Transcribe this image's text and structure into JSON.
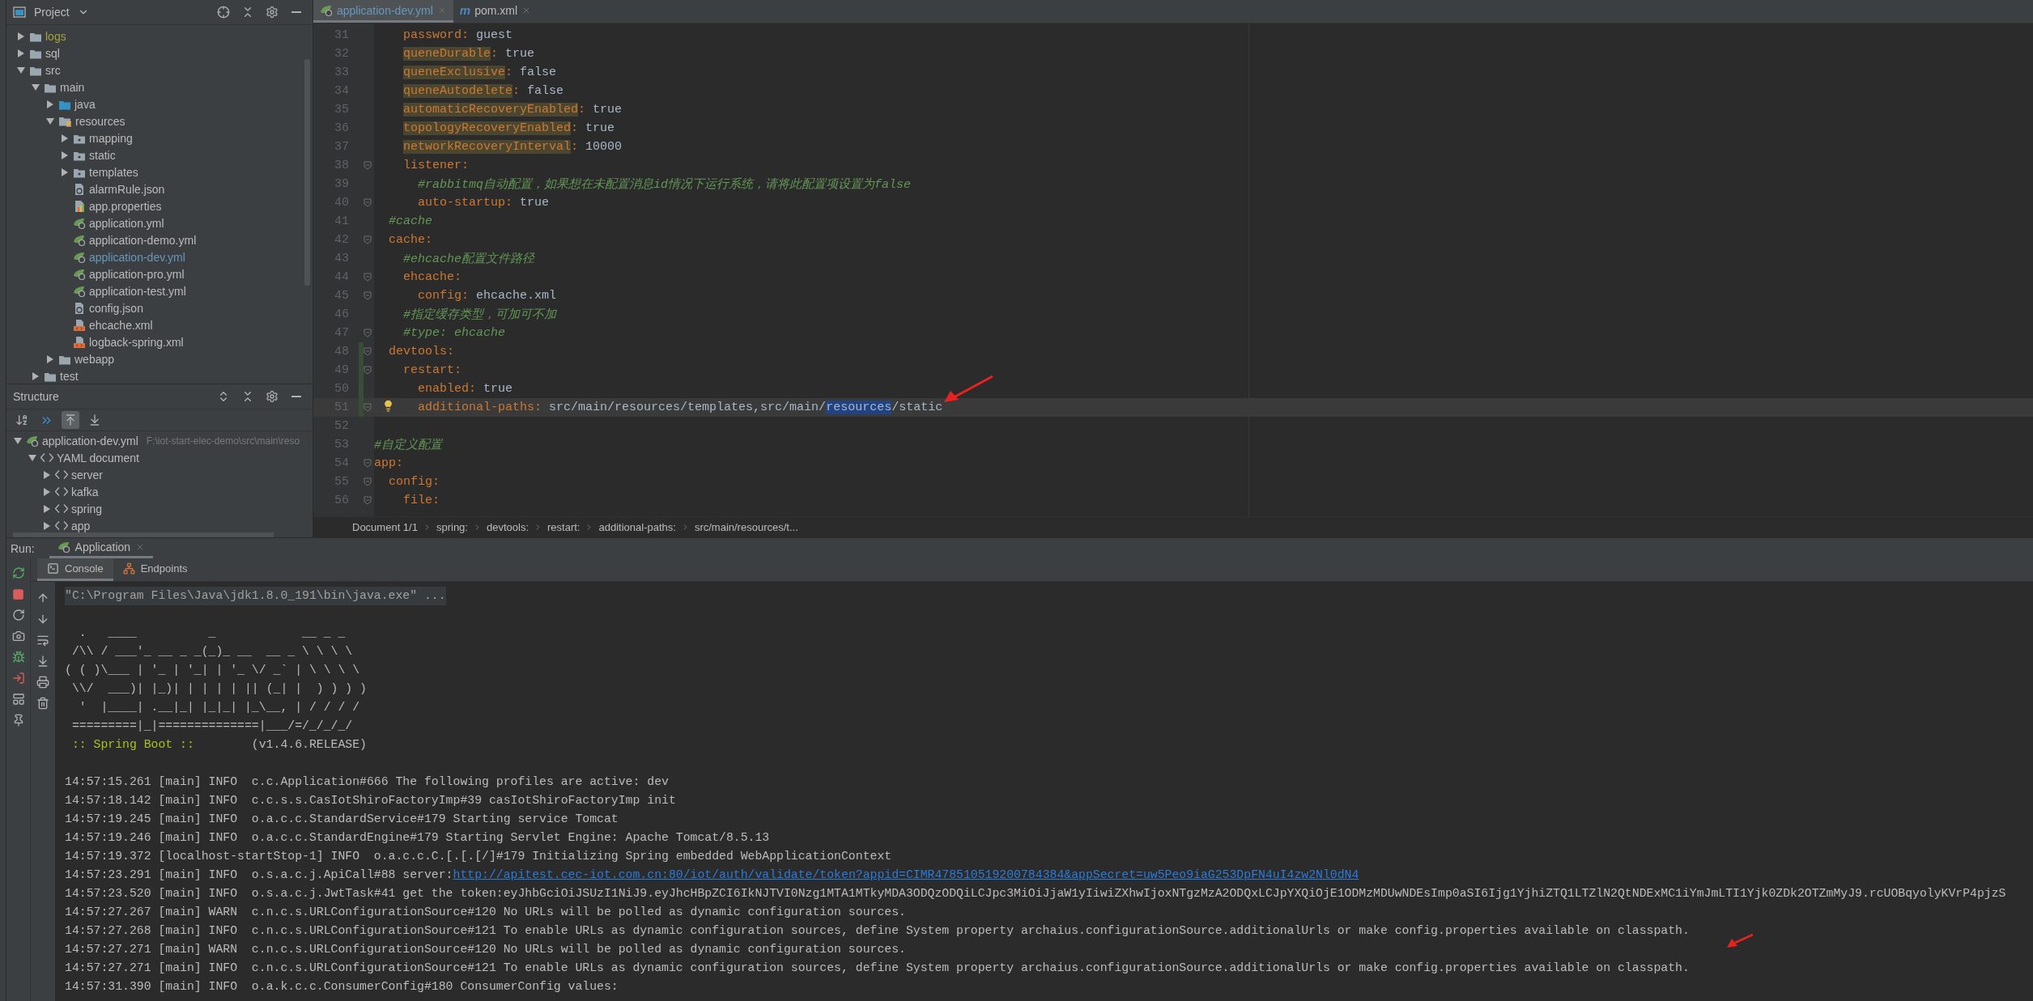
{
  "project_panel": {
    "title": "Project",
    "tree": [
      {
        "label": "logs",
        "kind": "folder",
        "color": "#a3a33b",
        "expanded": false
      },
      {
        "label": "sql",
        "kind": "folder",
        "color": "#bbbbbb",
        "expanded": false
      },
      {
        "label": "src",
        "kind": "folder",
        "color": "#bbbbbb",
        "expanded": true,
        "children": [
          {
            "label": "main",
            "kind": "folder",
            "color": "#bbbbbb",
            "expanded": true,
            "children": [
              {
                "label": "java",
                "kind": "source",
                "color": "#bbbbbb",
                "expanded": false
              },
              {
                "label": "resources",
                "kind": "resources",
                "color": "#bbbbbb",
                "expanded": true,
                "children": [
                  {
                    "label": "mapping",
                    "kind": "package",
                    "color": "#bbbbbb",
                    "expanded": false
                  },
                  {
                    "label": "static",
                    "kind": "package",
                    "color": "#bbbbbb",
                    "expanded": false
                  },
                  {
                    "label": "templates",
                    "kind": "package",
                    "color": "#bbbbbb",
                    "expanded": false
                  },
                  {
                    "label": "alarmRule.json",
                    "kind": "json",
                    "color": "#bbbbbb"
                  },
                  {
                    "label": "app.properties",
                    "kind": "properties",
                    "color": "#bbbbbb"
                  },
                  {
                    "label": "application.yml",
                    "kind": "yml",
                    "color": "#bbbbbb"
                  },
                  {
                    "label": "application-demo.yml",
                    "kind": "yml",
                    "color": "#bbbbbb"
                  },
                  {
                    "label": "application-dev.yml",
                    "kind": "yml",
                    "color": "#6897bb"
                  },
                  {
                    "label": "application-pro.yml",
                    "kind": "yml",
                    "color": "#bbbbbb"
                  },
                  {
                    "label": "application-test.yml",
                    "kind": "yml",
                    "color": "#bbbbbb"
                  },
                  {
                    "label": "config.json",
                    "kind": "json",
                    "color": "#bbbbbb"
                  },
                  {
                    "label": "ehcache.xml",
                    "kind": "xml",
                    "color": "#bbbbbb"
                  },
                  {
                    "label": "logback-spring.xml",
                    "kind": "xml",
                    "color": "#bbbbbb"
                  }
                ]
              },
              {
                "label": "webapp",
                "kind": "folder",
                "color": "#bbbbbb",
                "expanded": false
              }
            ]
          },
          {
            "label": "test",
            "kind": "folder",
            "color": "#bbbbbb",
            "expanded": false
          }
        ]
      }
    ]
  },
  "structure_panel": {
    "title": "Structure",
    "toolbar": [
      {
        "kind": "sort",
        "selected": false
      },
      {
        "kind": "navigate",
        "selected": false
      },
      {
        "kind": "from-source",
        "selected": true
      },
      {
        "kind": "to-source",
        "selected": false
      }
    ],
    "tree": [
      {
        "label": "application-dev.yml",
        "path": "F:\\iot-start-elec-demo\\src\\main\\reso",
        "kind": "yml",
        "expanded": true,
        "children": [
          {
            "label": "YAML document",
            "kind": "yaml",
            "expanded": true,
            "children": [
              {
                "label": "server",
                "kind": "yaml",
                "expanded": false
              },
              {
                "label": "kafka",
                "kind": "yaml",
                "expanded": false
              },
              {
                "label": "spring",
                "kind": "yaml",
                "expanded": false
              },
              {
                "label": "app",
                "kind": "yaml",
                "expanded": false
              }
            ]
          }
        ]
      }
    ]
  },
  "editor": {
    "tabs": [
      {
        "label": "application-dev.yml",
        "kind": "yml",
        "selected": true
      },
      {
        "label": "pom.xml",
        "kind": "maven",
        "badge": "m",
        "selected": false
      }
    ],
    "lines": [
      {
        "number": "31",
        "current": false,
        "changed": false,
        "fold": false,
        "tokens": [
          {
            "kind": "key",
            "text": "    password",
            "flagged": false
          },
          {
            "kind": "punct",
            "text": ":"
          },
          {
            "kind": "value",
            "text": "guest"
          }
        ]
      },
      {
        "number": "32",
        "current": false,
        "changed": false,
        "fold": false,
        "tokens": [
          {
            "kind": "key",
            "text": "    queneDurable",
            "flagged": true
          },
          {
            "kind": "punct",
            "text": ":"
          },
          {
            "kind": "value",
            "text": "true"
          }
        ]
      },
      {
        "number": "33",
        "current": false,
        "changed": false,
        "fold": false,
        "tokens": [
          {
            "kind": "key",
            "text": "    queneExclusive",
            "flagged": true
          },
          {
            "kind": "punct",
            "text": ":"
          },
          {
            "kind": "value",
            "text": "false"
          }
        ]
      },
      {
        "number": "34",
        "current": false,
        "changed": false,
        "fold": false,
        "tokens": [
          {
            "kind": "key",
            "text": "    queneAutodelete",
            "flagged": true
          },
          {
            "kind": "punct",
            "text": ":"
          },
          {
            "kind": "value",
            "text": "false"
          }
        ]
      },
      {
        "number": "35",
        "current": false,
        "changed": false,
        "fold": false,
        "tokens": [
          {
            "kind": "key",
            "text": "    automaticRecoveryEnabled",
            "flagged": true
          },
          {
            "kind": "punct",
            "text": ":"
          },
          {
            "kind": "value",
            "text": "true"
          }
        ]
      },
      {
        "number": "36",
        "current": false,
        "changed": false,
        "fold": false,
        "tokens": [
          {
            "kind": "key",
            "text": "    topologyRecoveryEnabled",
            "flagged": true
          },
          {
            "kind": "punct",
            "text": ":"
          },
          {
            "kind": "value",
            "text": "true"
          }
        ]
      },
      {
        "number": "37",
        "current": false,
        "changed": false,
        "fold": false,
        "tokens": [
          {
            "kind": "key",
            "text": "    networkRecoveryInterval",
            "flagged": true
          },
          {
            "kind": "punct",
            "text": ":"
          },
          {
            "kind": "value",
            "text": "10000"
          }
        ]
      },
      {
        "number": "38",
        "current": false,
        "changed": false,
        "fold": true,
        "tokens": [
          {
            "kind": "key",
            "text": "    listener",
            "flagged": false
          },
          {
            "kind": "punct",
            "text": ":"
          }
        ]
      },
      {
        "number": "39",
        "current": false,
        "changed": false,
        "fold": false,
        "tokens": [
          {
            "kind": "comment",
            "text": "      #rabbitmq自动配置，如果想在未配置消息id情况下运行系统，请将此配置项设置为false"
          }
        ]
      },
      {
        "number": "40",
        "current": false,
        "changed": false,
        "fold": true,
        "tokens": [
          {
            "kind": "key",
            "text": "      auto-startup",
            "flagged": false
          },
          {
            "kind": "punct",
            "text": ":"
          },
          {
            "kind": "value",
            "text": "true"
          }
        ]
      },
      {
        "number": "41",
        "current": false,
        "changed": false,
        "fold": false,
        "tokens": [
          {
            "kind": "comment",
            "text": "  #cache"
          }
        ]
      },
      {
        "number": "42",
        "current": false,
        "changed": false,
        "fold": true,
        "tokens": [
          {
            "kind": "key",
            "text": "  cache",
            "flagged": false
          },
          {
            "kind": "punct",
            "text": ":"
          }
        ]
      },
      {
        "number": "43",
        "current": false,
        "changed": false,
        "fold": false,
        "tokens": [
          {
            "kind": "comment",
            "text": "    #ehcache配置文件路径"
          }
        ]
      },
      {
        "number": "44",
        "current": false,
        "changed": false,
        "fold": true,
        "tokens": [
          {
            "kind": "key",
            "text": "    ehcache",
            "flagged": false
          },
          {
            "kind": "punct",
            "text": ":"
          }
        ]
      },
      {
        "number": "45",
        "current": false,
        "changed": false,
        "fold": true,
        "tokens": [
          {
            "kind": "key",
            "text": "      config",
            "flagged": false
          },
          {
            "kind": "punct",
            "text": ":"
          },
          {
            "kind": "value",
            "text": "ehcache.xml"
          }
        ]
      },
      {
        "number": "46",
        "current": false,
        "changed": false,
        "fold": false,
        "tokens": [
          {
            "kind": "comment",
            "text": "    #指定缓存类型，可加可不加"
          }
        ]
      },
      {
        "number": "47",
        "current": false,
        "changed": false,
        "fold": true,
        "tokens": [
          {
            "kind": "comment",
            "text": "    #type: ehcache"
          }
        ]
      },
      {
        "number": "48",
        "current": false,
        "changed": true,
        "fold": true,
        "tokens": [
          {
            "kind": "key",
            "text": "  devtools",
            "flagged": false
          },
          {
            "kind": "punct",
            "text": ":"
          }
        ]
      },
      {
        "number": "49",
        "current": false,
        "changed": true,
        "fold": true,
        "tokens": [
          {
            "kind": "key",
            "text": "    restart",
            "flagged": false
          },
          {
            "kind": "punct",
            "text": ":"
          }
        ]
      },
      {
        "number": "50",
        "current": false,
        "changed": true,
        "fold": false,
        "tokens": [
          {
            "kind": "key",
            "text": "      enabled",
            "flagged": false
          },
          {
            "kind": "punct",
            "text": ":"
          },
          {
            "kind": "value",
            "text": "true"
          }
        ]
      },
      {
        "number": "51",
        "current": true,
        "changed": true,
        "fold": true,
        "hint": true,
        "tokens": [
          {
            "kind": "key",
            "text": "      additional-paths",
            "flagged": false
          },
          {
            "kind": "punct",
            "text": ":"
          },
          {
            "kind": "value",
            "text": "src/main/resources/templates,src/main/",
            "selected": false
          },
          {
            "kind": "value",
            "text": "resources",
            "selected": true,
            "joined": true
          },
          {
            "kind": "value",
            "text": "/static",
            "selected": false,
            "joined": true
          }
        ]
      },
      {
        "number": "52",
        "current": false,
        "changed": false,
        "fold": false
      },
      {
        "number": "53",
        "current": false,
        "changed": false,
        "fold": false,
        "tokens": [
          {
            "kind": "comment",
            "text": "#自定义配置"
          }
        ]
      },
      {
        "number": "54",
        "current": false,
        "changed": false,
        "fold": true,
        "tokens": [
          {
            "kind": "key",
            "text": "app",
            "flagged": false
          },
          {
            "kind": "punct",
            "text": ":"
          }
        ]
      },
      {
        "number": "55",
        "current": false,
        "changed": false,
        "fold": true,
        "tokens": [
          {
            "kind": "key",
            "text": "  config",
            "flagged": false
          },
          {
            "kind": "punct",
            "text": ":"
          }
        ]
      },
      {
        "number": "56",
        "current": false,
        "changed": false,
        "fold": true,
        "tokens": [
          {
            "kind": "key",
            "text": "    file",
            "flagged": false
          },
          {
            "kind": "punct",
            "text": ":"
          }
        ]
      }
    ],
    "breadcrumbs": [
      "Document 1/1",
      "spring:",
      "devtools:",
      "restart:",
      "additional-paths:",
      "src/main/resources/t..."
    ]
  },
  "run_panel": {
    "label": "Run:",
    "tabs": [
      {
        "label": "Application",
        "selected": true
      }
    ],
    "subtabs": [
      {
        "label": "Console",
        "kind": "console",
        "selected": true
      },
      {
        "label": "Endpoints",
        "kind": "endpoints",
        "selected": false
      }
    ],
    "console": {
      "command": "\"C:\\Program Files\\Java\\jdk1.8.0_191\\bin\\java.exe\" ...",
      "banner": [
        "  .   ____          _            __ _ _",
        " /\\\\ / ___'_ __ _ _(_)_ __  __ _ \\ \\ \\ \\",
        "( ( )\\___ | '_ | '_| | '_ \\/ _` | \\ \\ \\ \\",
        " \\\\/  ___)| |_)| | | | | || (_| |  ) ) ) )",
        "  '  |____| .__|_| |_|_| |_\\__, | / / / /",
        " =========|_|==============|___/=/_/_/_/"
      ],
      "spring_boot": {
        "label": ":: Spring Boot ::",
        "version": "(v1.4.6.RELEASE)"
      },
      "log": [
        {
          "text": "14:57:15.261 [main] INFO  c.c.Application#666 The following profiles are active: dev"
        },
        {
          "text": "14:57:18.142 [main] INFO  c.c.s.s.CasIotShiroFactoryImp#39 casIotShiroFactoryImp init"
        },
        {
          "text": "14:57:19.245 [main] INFO  o.a.c.c.StandardService#179 Starting service Tomcat"
        },
        {
          "text": "14:57:19.246 [main] INFO  o.a.c.c.StandardEngine#179 Starting Servlet Engine: Apache Tomcat/8.5.13"
        },
        {
          "text": "14:57:19.372 [localhost-startStop-1] INFO  o.a.c.c.C.[.[.[/]#179 Initializing Spring embedded WebApplicationContext"
        },
        {
          "text": "14:57:23.291 [main] INFO  o.s.a.c.j.ApiCall#88 server:",
          "link": "http://apitest.cec-iot.com.cn:80/iot/auth/validate/token?appid=CIMR478510519200784384&appSecret=uw5Peo9iaG253DpFN4uI4zw2Nl0dN4"
        },
        {
          "text": "14:57:23.520 [main] INFO  o.s.a.c.j.JwtTask#41 get the token:eyJhbGciOiJSUzI1NiJ9.eyJhcHBpZCI6IkNJTVI0Nzg1MTA1MTkyMDA3ODQzODQiLCJpc3MiOiJjaW1yIiwiZXhwIjoxNTgzMzA2ODQxLCJpYXQiOjE1ODMzMDUwNDEsImp0aSI6Ijg1YjhiZTQ1LTZlN2QtNDExMC1iYmJmLTI1Yjk0ZDk2OTZmMyJ9.rcUOBqyolyKVrP4pjzS"
        },
        {
          "text": "14:57:27.267 [main] WARN  c.n.c.s.URLConfigurationSource#120 No URLs will be polled as dynamic configuration sources."
        },
        {
          "text": "14:57:27.268 [main] INFO  c.n.c.s.URLConfigurationSource#121 To enable URLs as dynamic configuration sources, define System property archaius.configurationSource.additionalUrls or make config.properties available on classpath."
        },
        {
          "text": "14:57:27.271 [main] WARN  c.n.c.s.URLConfigurationSource#120 No URLs will be polled as dynamic configuration sources."
        },
        {
          "text": "14:57:27.271 [main] INFO  c.n.c.s.URLConfigurationSource#121 To enable URLs as dynamic configuration sources, define System property archaius.configurationSource.additionalUrls or make config.properties available on classpath."
        },
        {
          "text": "14:57:31.390 [main] INFO  o.a.k.c.c.ConsumerConfig#180 ConsumerConfig values:"
        }
      ]
    }
  }
}
